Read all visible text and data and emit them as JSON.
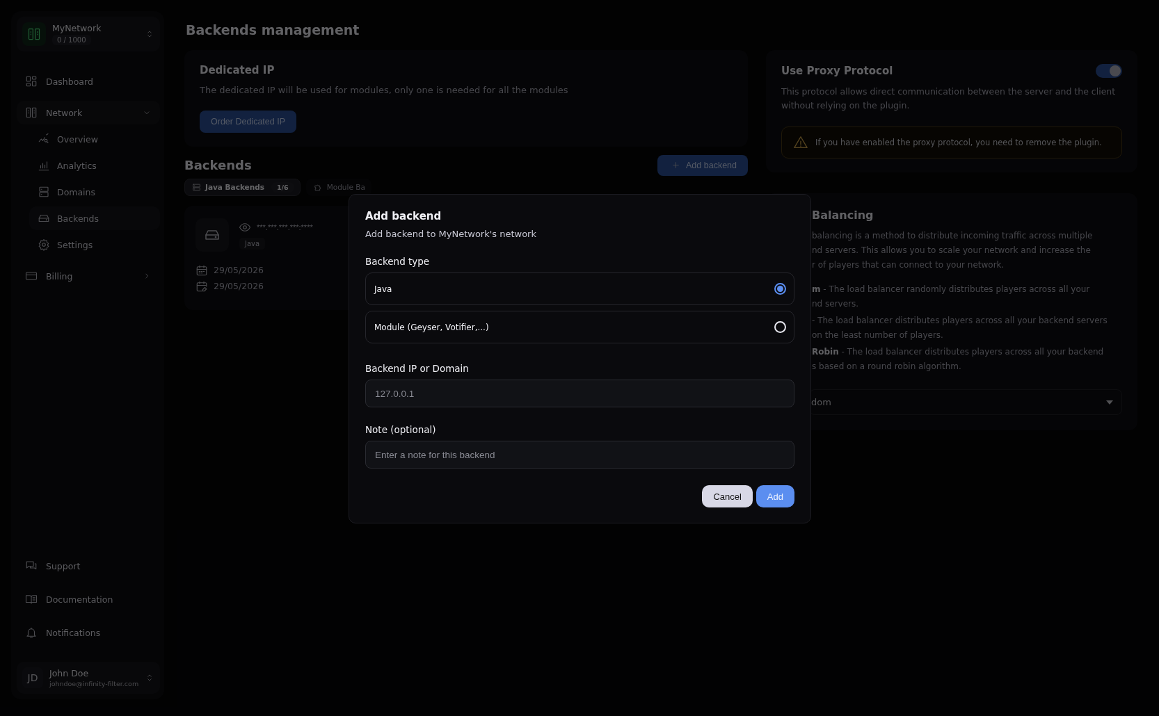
{
  "sidebar": {
    "network": {
      "name": "MyNetwork",
      "usage": "0 / 1000"
    },
    "nav": [
      {
        "label": "Dashboard",
        "kind": "link"
      },
      {
        "label": "Network",
        "kind": "group",
        "expanded": true,
        "children": [
          {
            "label": "Overview",
            "selected": false
          },
          {
            "label": "Analytics",
            "selected": false
          },
          {
            "label": "Domains",
            "selected": false
          },
          {
            "label": "Backends",
            "selected": true
          },
          {
            "label": "Settings",
            "selected": false
          }
        ]
      },
      {
        "label": "Billing",
        "kind": "group",
        "expanded": false
      }
    ],
    "footer": [
      {
        "label": "Support"
      },
      {
        "label": "Documentation"
      },
      {
        "label": "Notifications"
      }
    ],
    "user": {
      "initials": "JD",
      "name": "John Doe",
      "email": "johndoe@infinity-filter.com"
    }
  },
  "page_title": "Backends management",
  "dedicated_ip": {
    "title": "Dedicated IP",
    "description": "The dedicated IP will be used for modules, only one is needed for all the modules",
    "button": "Order Dedicated IP"
  },
  "backends": {
    "title": "Backends",
    "add_button": "Add backend",
    "tabs": [
      {
        "label": "Java Backends",
        "count": "1/6",
        "selected": true
      },
      {
        "label": "Module Ba",
        "selected": false
      }
    ],
    "card": {
      "address": "***.***.***.***:****",
      "tag": "Java",
      "dates": [
        "29/05/2026",
        "29/05/2026"
      ]
    }
  },
  "proxy_protocol": {
    "title": "Use Proxy Protocol",
    "on": true,
    "description": "This protocol allows direct communication between the server and the client without relying on the plugin.",
    "warning": "If you have enabled the proxy protocol, you need to remove the plugin."
  },
  "load_balancing": {
    "title": "Balancing",
    "description": [
      "balancing is a method to distribute incoming traffic across multiple",
      "nd servers. This allows you to scale your network and increase the",
      "r of players that can connect to your network."
    ],
    "modes": [
      [
        "**m** - The load balancer randomly distributes players across all your",
        "nd servers."
      ],
      [
        "- The load balancer distributes players across all your backend servers",
        "on the least number of players."
      ],
      [
        "**Robin** - The load balancer distributes players across all your backend",
        "s based on a round robin algorithm."
      ]
    ],
    "select": {
      "value": "dom"
    }
  },
  "modal": {
    "title": "Add backend",
    "subtitle": "Add backend to MyNetwork's network",
    "type_label": "Backend type",
    "options": [
      {
        "label": "Java",
        "selected": true
      },
      {
        "label": "Module (Geyser, Votifier,...)",
        "selected": false
      }
    ],
    "fields": [
      {
        "label": "Backend IP or Domain",
        "placeholder": "127.0.0.1"
      },
      {
        "label": "Note (optional)",
        "placeholder": "Enter a note for this backend"
      }
    ],
    "buttons": [
      {
        "label": "Cancel",
        "kind": "secondary"
      },
      {
        "label": "Add",
        "kind": "primary"
      }
    ]
  }
}
